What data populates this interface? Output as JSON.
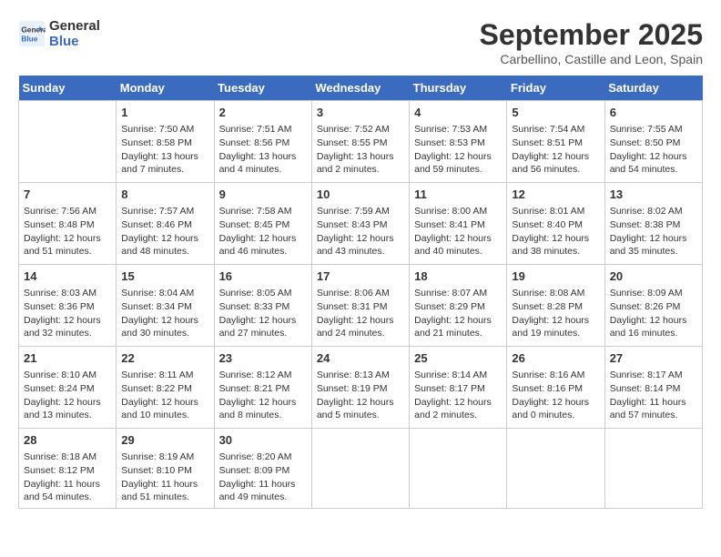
{
  "header": {
    "logo_line1": "General",
    "logo_line2": "Blue",
    "month_title": "September 2025",
    "location": "Carbellino, Castille and Leon, Spain"
  },
  "weekdays": [
    "Sunday",
    "Monday",
    "Tuesday",
    "Wednesday",
    "Thursday",
    "Friday",
    "Saturday"
  ],
  "weeks": [
    [
      {
        "day": "",
        "text": ""
      },
      {
        "day": "1",
        "text": "Sunrise: 7:50 AM\nSunset: 8:58 PM\nDaylight: 13 hours\nand 7 minutes."
      },
      {
        "day": "2",
        "text": "Sunrise: 7:51 AM\nSunset: 8:56 PM\nDaylight: 13 hours\nand 4 minutes."
      },
      {
        "day": "3",
        "text": "Sunrise: 7:52 AM\nSunset: 8:55 PM\nDaylight: 13 hours\nand 2 minutes."
      },
      {
        "day": "4",
        "text": "Sunrise: 7:53 AM\nSunset: 8:53 PM\nDaylight: 12 hours\nand 59 minutes."
      },
      {
        "day": "5",
        "text": "Sunrise: 7:54 AM\nSunset: 8:51 PM\nDaylight: 12 hours\nand 56 minutes."
      },
      {
        "day": "6",
        "text": "Sunrise: 7:55 AM\nSunset: 8:50 PM\nDaylight: 12 hours\nand 54 minutes."
      }
    ],
    [
      {
        "day": "7",
        "text": "Sunrise: 7:56 AM\nSunset: 8:48 PM\nDaylight: 12 hours\nand 51 minutes."
      },
      {
        "day": "8",
        "text": "Sunrise: 7:57 AM\nSunset: 8:46 PM\nDaylight: 12 hours\nand 48 minutes."
      },
      {
        "day": "9",
        "text": "Sunrise: 7:58 AM\nSunset: 8:45 PM\nDaylight: 12 hours\nand 46 minutes."
      },
      {
        "day": "10",
        "text": "Sunrise: 7:59 AM\nSunset: 8:43 PM\nDaylight: 12 hours\nand 43 minutes."
      },
      {
        "day": "11",
        "text": "Sunrise: 8:00 AM\nSunset: 8:41 PM\nDaylight: 12 hours\nand 40 minutes."
      },
      {
        "day": "12",
        "text": "Sunrise: 8:01 AM\nSunset: 8:40 PM\nDaylight: 12 hours\nand 38 minutes."
      },
      {
        "day": "13",
        "text": "Sunrise: 8:02 AM\nSunset: 8:38 PM\nDaylight: 12 hours\nand 35 minutes."
      }
    ],
    [
      {
        "day": "14",
        "text": "Sunrise: 8:03 AM\nSunset: 8:36 PM\nDaylight: 12 hours\nand 32 minutes."
      },
      {
        "day": "15",
        "text": "Sunrise: 8:04 AM\nSunset: 8:34 PM\nDaylight: 12 hours\nand 30 minutes."
      },
      {
        "day": "16",
        "text": "Sunrise: 8:05 AM\nSunset: 8:33 PM\nDaylight: 12 hours\nand 27 minutes."
      },
      {
        "day": "17",
        "text": "Sunrise: 8:06 AM\nSunset: 8:31 PM\nDaylight: 12 hours\nand 24 minutes."
      },
      {
        "day": "18",
        "text": "Sunrise: 8:07 AM\nSunset: 8:29 PM\nDaylight: 12 hours\nand 21 minutes."
      },
      {
        "day": "19",
        "text": "Sunrise: 8:08 AM\nSunset: 8:28 PM\nDaylight: 12 hours\nand 19 minutes."
      },
      {
        "day": "20",
        "text": "Sunrise: 8:09 AM\nSunset: 8:26 PM\nDaylight: 12 hours\nand 16 minutes."
      }
    ],
    [
      {
        "day": "21",
        "text": "Sunrise: 8:10 AM\nSunset: 8:24 PM\nDaylight: 12 hours\nand 13 minutes."
      },
      {
        "day": "22",
        "text": "Sunrise: 8:11 AM\nSunset: 8:22 PM\nDaylight: 12 hours\nand 10 minutes."
      },
      {
        "day": "23",
        "text": "Sunrise: 8:12 AM\nSunset: 8:21 PM\nDaylight: 12 hours\nand 8 minutes."
      },
      {
        "day": "24",
        "text": "Sunrise: 8:13 AM\nSunset: 8:19 PM\nDaylight: 12 hours\nand 5 minutes."
      },
      {
        "day": "25",
        "text": "Sunrise: 8:14 AM\nSunset: 8:17 PM\nDaylight: 12 hours\nand 2 minutes."
      },
      {
        "day": "26",
        "text": "Sunrise: 8:16 AM\nSunset: 8:16 PM\nDaylight: 12 hours\nand 0 minutes."
      },
      {
        "day": "27",
        "text": "Sunrise: 8:17 AM\nSunset: 8:14 PM\nDaylight: 11 hours\nand 57 minutes."
      }
    ],
    [
      {
        "day": "28",
        "text": "Sunrise: 8:18 AM\nSunset: 8:12 PM\nDaylight: 11 hours\nand 54 minutes."
      },
      {
        "day": "29",
        "text": "Sunrise: 8:19 AM\nSunset: 8:10 PM\nDaylight: 11 hours\nand 51 minutes."
      },
      {
        "day": "30",
        "text": "Sunrise: 8:20 AM\nSunset: 8:09 PM\nDaylight: 11 hours\nand 49 minutes."
      },
      {
        "day": "",
        "text": ""
      },
      {
        "day": "",
        "text": ""
      },
      {
        "day": "",
        "text": ""
      },
      {
        "day": "",
        "text": ""
      }
    ]
  ]
}
